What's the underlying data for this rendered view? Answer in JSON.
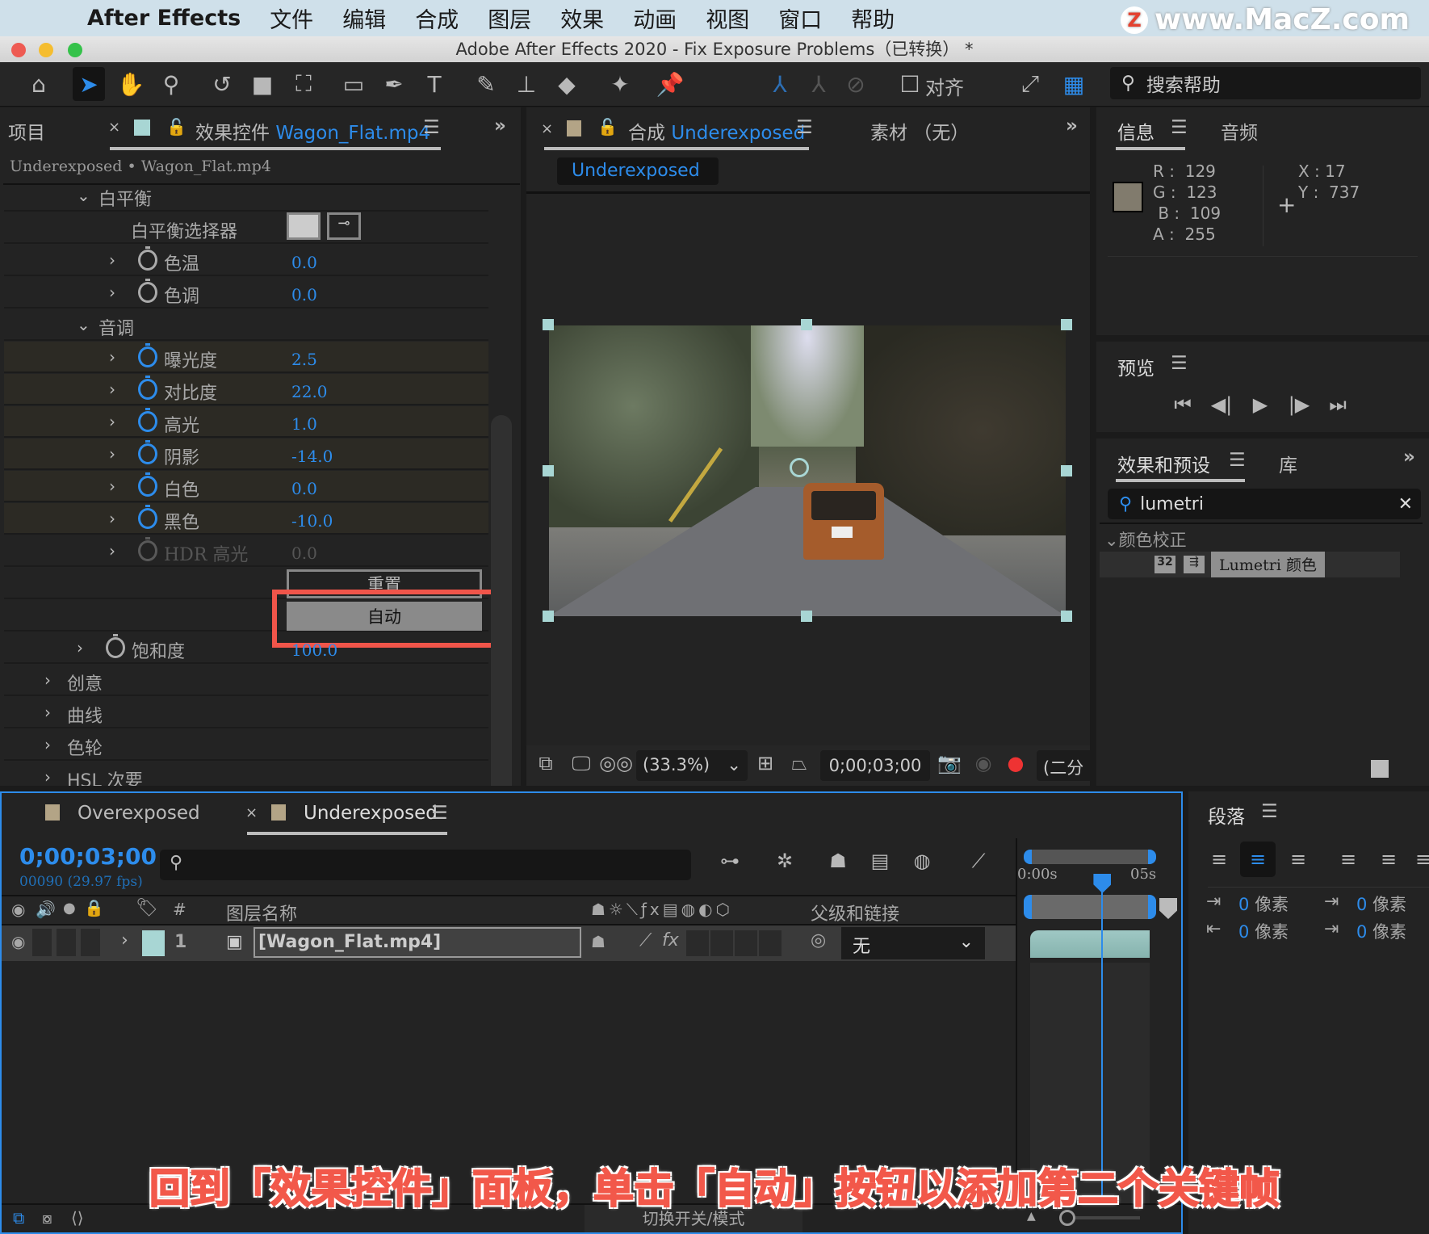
{
  "menubar": {
    "app_name": "After Effects",
    "items": [
      "文件",
      "编辑",
      "合成",
      "图层",
      "效果",
      "动画",
      "视图",
      "窗口",
      "帮助"
    ],
    "watermark": "www.MacZ.com"
  },
  "window": {
    "title": "Adobe After Effects 2020 - Fix Exposure Problems（已转换） *"
  },
  "toolbar": {
    "tools": [
      "home-icon",
      "selection-tool-icon",
      "hand-tool-icon",
      "zoom-tool-icon",
      "rotate-tool-icon",
      "camera-tool-icon",
      "pan-behind-tool-icon",
      "rectangle-tool-icon",
      "pen-tool-icon",
      "type-tool-icon",
      "brush-tool-icon",
      "clone-stamp-icon",
      "eraser-icon",
      "roto-brush-icon",
      "puppet-pin-icon"
    ],
    "align_label": "对齐",
    "search_placeholder": "搜索帮助"
  },
  "effects_panel": {
    "tab_project": "项目",
    "tab_effect_controls": "效果控件",
    "tab_file": "Wagon_Flat.mp4",
    "breadcrumb": "Underexposed • Wagon_Flat.mp4",
    "white_balance": {
      "label": "白平衡",
      "picker_label": "白平衡选择器"
    },
    "wb_props": [
      {
        "label": "色温",
        "value": "0.0"
      },
      {
        "label": "色调",
        "value": "0.0"
      }
    ],
    "tone": {
      "label": "音调"
    },
    "tone_props": [
      {
        "label": "曝光度",
        "value": "2.5"
      },
      {
        "label": "对比度",
        "value": "22.0"
      },
      {
        "label": "高光",
        "value": "1.0"
      },
      {
        "label": "阴影",
        "value": "-14.0"
      },
      {
        "label": "白色",
        "value": "0.0"
      },
      {
        "label": "黑色",
        "value": "-10.0"
      },
      {
        "label": "HDR 高光",
        "value": "0.0"
      }
    ],
    "reset_label": "重置",
    "auto_label": "自动",
    "saturation": {
      "label": "饱和度",
      "value": "100.0"
    },
    "sections": [
      "创意",
      "曲线",
      "色轮",
      "HSL 次要"
    ]
  },
  "comp_panel": {
    "tab_prefix": "合成",
    "tab_name": "Underexposed",
    "footage_tab": "素材 （无）",
    "breadcrumb": "Underexposed",
    "zoom": "(33.3%)",
    "timecode": "0;00;03;00",
    "resolution": "(二分"
  },
  "info_panel": {
    "tab_info": "信息",
    "tab_audio": "音频",
    "swatch_color": "#817b6d",
    "r": "129",
    "g": "123",
    "b": "109",
    "a": "255",
    "x": "17",
    "y": "737"
  },
  "preview_panel": {
    "title": "预览"
  },
  "effects_presets": {
    "tab": "效果和预设",
    "tab_library": "库",
    "search_value": "lumetri",
    "category": "颜色校正",
    "item": "Lumetri 颜色",
    "badge": "32"
  },
  "timeline": {
    "tabs": [
      "Overexposed",
      "Underexposed"
    ],
    "timecode": "0;00;03;00",
    "frames": "00090 (29.97 fps)",
    "col_hash": "#",
    "col_layer_name": "图层名称",
    "col_parent": "父级和链接",
    "ruler_start": "0:00s",
    "ruler_end": "05s",
    "playhead_fraction": 0.6,
    "layer": {
      "index": "1",
      "name": "[Wagon_Flat.mp4]",
      "parent": "无"
    },
    "toggle_label": "切换开关/模式"
  },
  "paragraph_panel": {
    "title": "段落",
    "indents": [
      "0 像素",
      "0 像素",
      "0 像素",
      "0 像素"
    ]
  },
  "caption": "回到「效果控件」面板，单击「自动」按钮以添加第二个关键帧"
}
